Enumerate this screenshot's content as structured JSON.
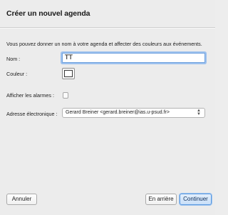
{
  "dialog": {
    "title": "Créer un nouvel agenda",
    "intro": "Vous pouvez donner un nom à votre agenda et affecter des couleurs aux événements."
  },
  "form": {
    "name_label": "Nom :",
    "name_value": "TT",
    "color_label": "Couleur :",
    "color_value": "#ffffff",
    "alarms_label": "Afficher les alarmes :",
    "alarms_checked": false,
    "email_label": "Adresse électronique :",
    "email_value": "Gerard Breiner <gerard.breiner@ias.u-psud.fr>"
  },
  "buttons": {
    "cancel": "Annuler",
    "back": "En arrière",
    "continue": "Continuer"
  },
  "colors": {
    "accent": "#6fa1de",
    "background": "#ececec"
  }
}
